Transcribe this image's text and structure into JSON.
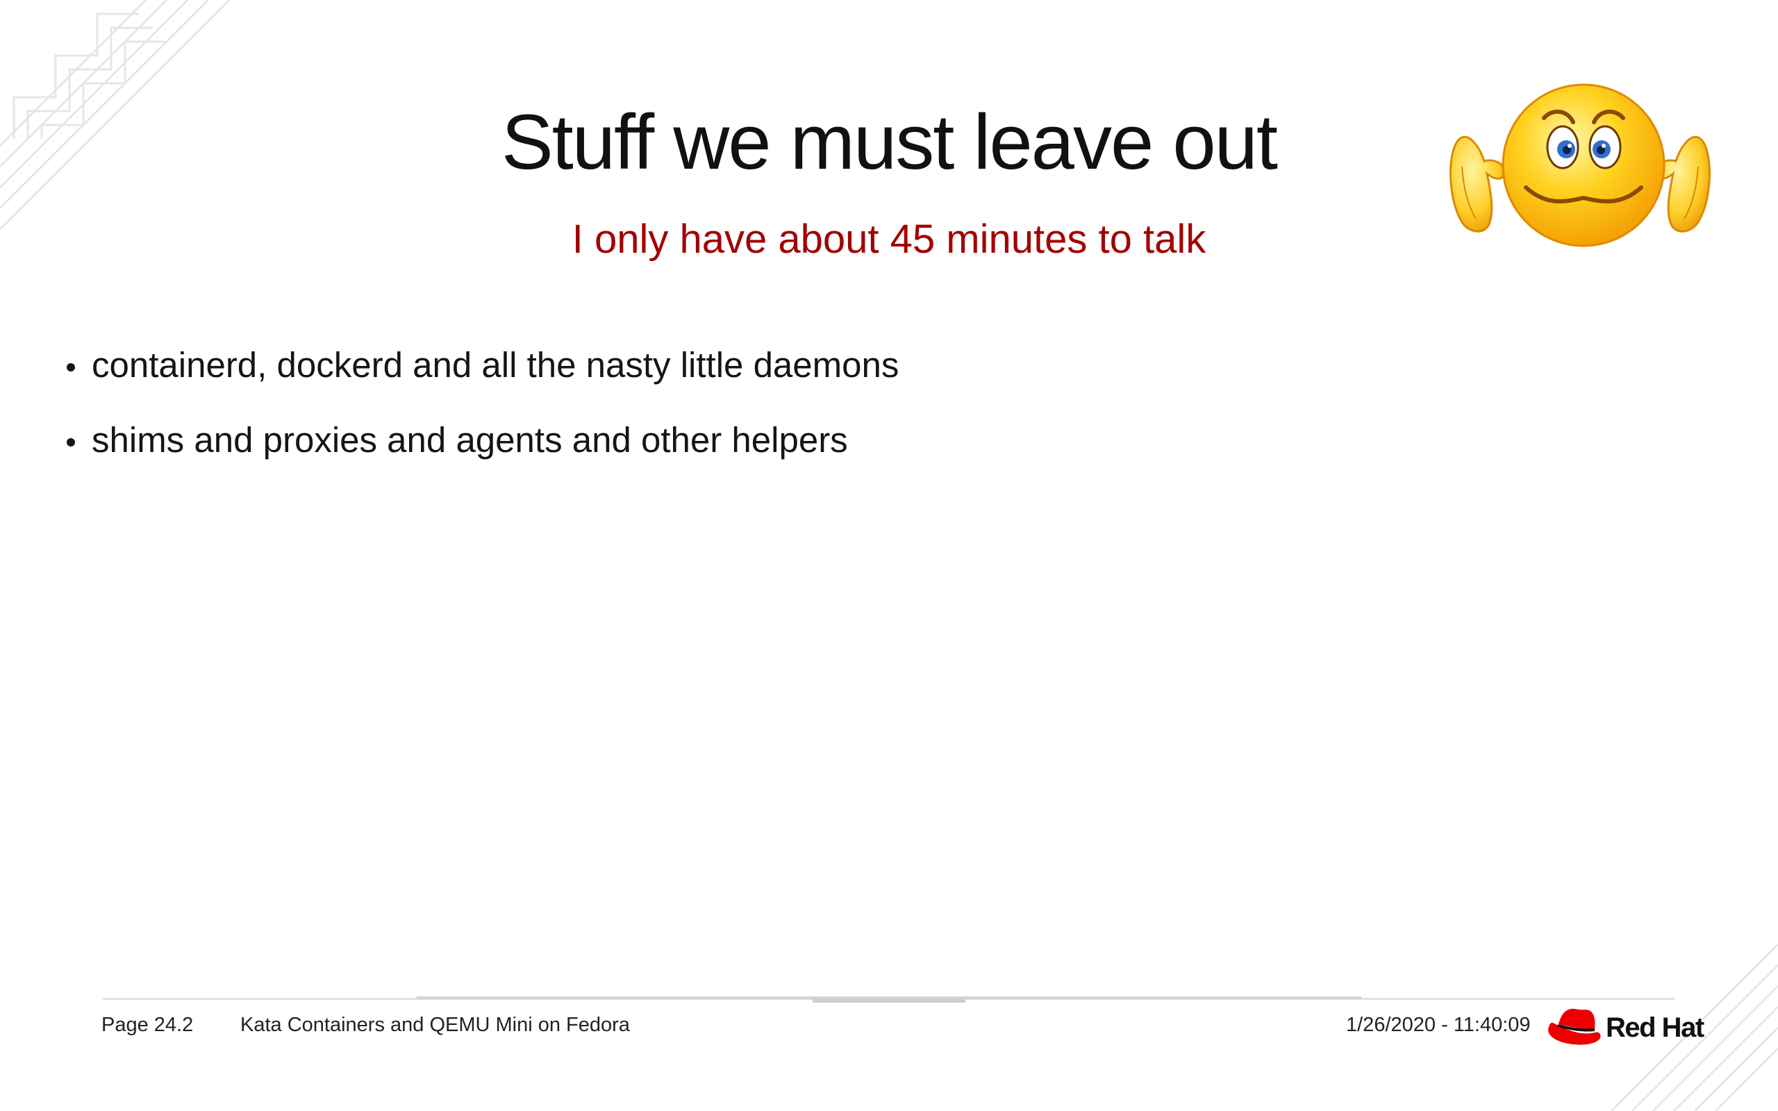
{
  "slide": {
    "title": "Stuff we must leave out",
    "subtitle": "I only have about 45 minutes to talk",
    "bullets": [
      "containerd, dockerd and all the nasty little daemons",
      "shims and proxies and agents and other helpers"
    ],
    "image": {
      "icon": "worried-shrugging-emoji-icon"
    }
  },
  "footer": {
    "page": "Page 24.2",
    "talk_title": "Kata Containers and QEMU Mini on Fedora",
    "datetime": "1/26/2020 - 11:40:09",
    "logo_text": "Red Hat"
  },
  "colors": {
    "accent": "#a30000",
    "text": "#151515",
    "logo_red": "#ee0000"
  }
}
